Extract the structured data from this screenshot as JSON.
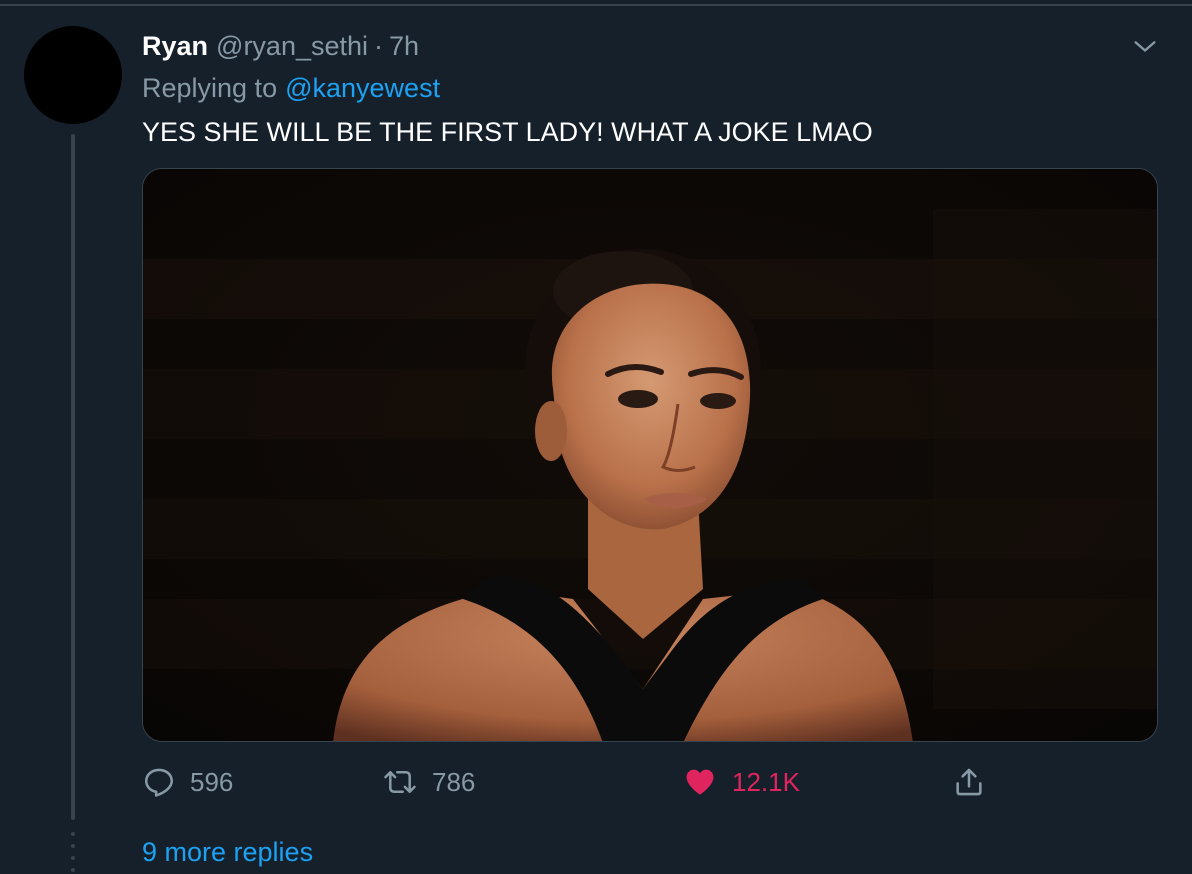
{
  "tweet": {
    "author_name": "Ryan",
    "author_handle": "@ryan_sethi",
    "separator": "·",
    "time": "7h",
    "replying_label": "Replying to",
    "replying_to": "@kanyewest",
    "text": "YES SHE WILL BE THE FIRST LADY! WHAT A JOKE LMAO"
  },
  "actions": {
    "reply": {
      "icon": "reply-icon",
      "count": "596"
    },
    "retweet": {
      "icon": "retweet-icon",
      "count": "786"
    },
    "like": {
      "icon": "heart-icon",
      "count": "12.1K",
      "active": true,
      "color": "#e0245e"
    },
    "share": {
      "icon": "share-icon"
    }
  },
  "thread": {
    "more_replies": "9 more replies"
  },
  "colors": {
    "background": "#15202b",
    "accent": "#1da1f2",
    "muted": "#8899a6",
    "divider": "#38444d",
    "like": "#e0245e"
  }
}
